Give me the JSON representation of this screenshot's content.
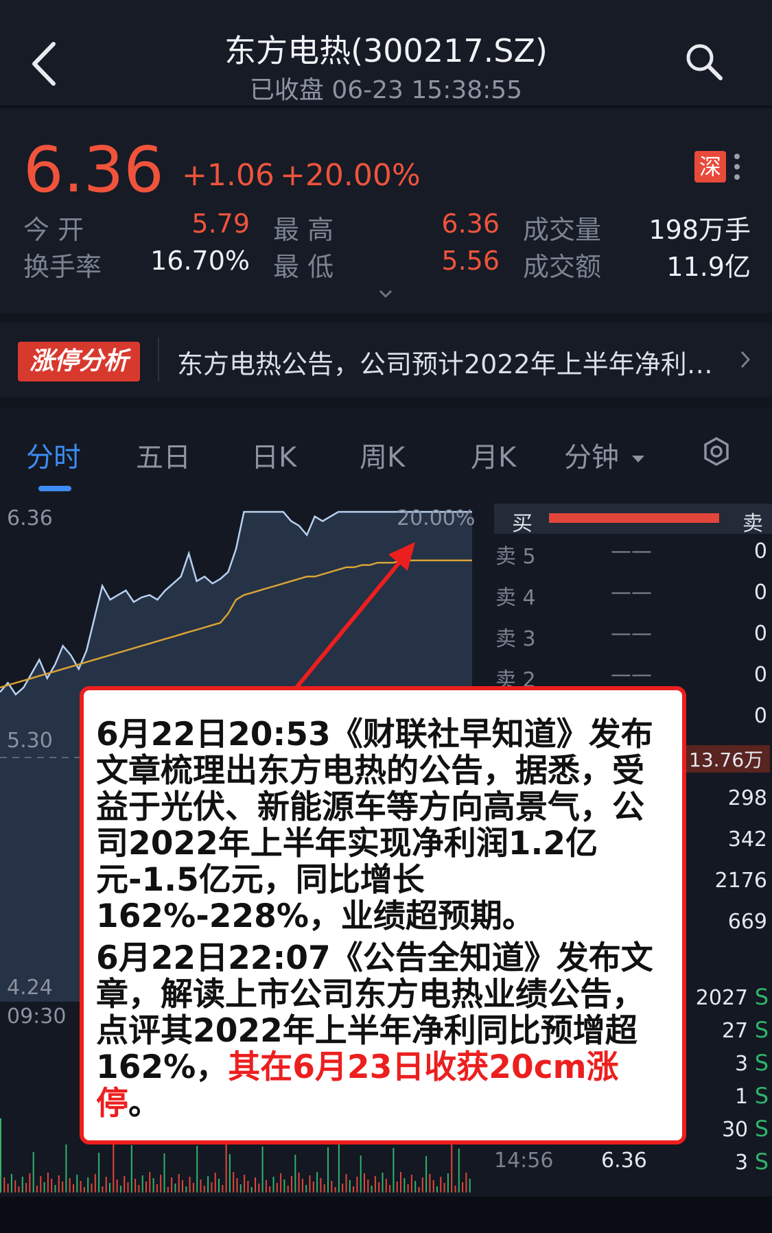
{
  "header": {
    "title": "东方电热(300217.SZ)",
    "subtitle": "已收盘 06-23 15:38:55"
  },
  "quote": {
    "price": "6.36",
    "change": "+1.06",
    "change_pct": "+20.00%",
    "exchange_badge": "深",
    "stats": {
      "open_label": "今 开",
      "open_value": "5.79",
      "turnover_label": "换手率",
      "turnover_value": "16.70%",
      "high_label": "最 高",
      "high_value": "6.36",
      "low_label": "最 低",
      "low_value": "5.56",
      "volume_label": "成交量",
      "volume_value": "198万手",
      "amount_label": "成交额",
      "amount_value": "11.9亿"
    }
  },
  "notice": {
    "tag": "涨停分析",
    "text": "东方电热公告，公司预计2022年上半年净利…"
  },
  "tabs": [
    {
      "label": "分时",
      "active": true
    },
    {
      "label": "五日"
    },
    {
      "label": "日K"
    },
    {
      "label": "周K"
    },
    {
      "label": "月K"
    },
    {
      "label": "分钟"
    }
  ],
  "chart_data": {
    "type": "line",
    "y_labels": [
      "6.36",
      "5.30",
      "4.24"
    ],
    "x_labels": [
      "09:30"
    ],
    "pct_label": "20.00%",
    "ylim": [
      4.24,
      6.36
    ],
    "price_series": [
      5.58,
      5.62,
      5.57,
      5.6,
      5.66,
      5.72,
      5.64,
      5.7,
      5.78,
      5.74,
      5.68,
      5.76,
      5.9,
      6.04,
      5.98,
      6.0,
      6.02,
      5.97,
      5.99,
      6.0,
      5.98,
      6.02,
      6.05,
      6.08,
      6.18,
      6.06,
      6.08,
      6.05,
      6.07,
      6.1,
      6.2,
      6.36,
      6.36,
      6.36,
      6.36,
      6.36,
      6.36,
      6.32,
      6.3,
      6.26,
      6.34,
      6.32,
      6.34,
      6.36,
      6.36,
      6.36,
      6.36,
      6.36,
      6.36,
      6.36,
      6.36,
      6.36,
      6.36,
      6.36,
      6.36,
      6.36,
      6.36,
      6.36,
      6.36,
      6.36,
      6.36
    ],
    "avg_series": [
      5.6,
      5.61,
      5.62,
      5.63,
      5.64,
      5.65,
      5.66,
      5.67,
      5.68,
      5.69,
      5.7,
      5.71,
      5.72,
      5.73,
      5.74,
      5.75,
      5.76,
      5.77,
      5.78,
      5.79,
      5.8,
      5.81,
      5.82,
      5.83,
      5.84,
      5.85,
      5.86,
      5.87,
      5.88,
      5.92,
      5.98,
      6.0,
      6.01,
      6.02,
      6.03,
      6.04,
      6.05,
      6.06,
      6.07,
      6.08,
      6.08,
      6.09,
      6.1,
      6.11,
      6.12,
      6.12,
      6.13,
      6.13,
      6.14,
      6.14,
      6.14,
      6.15,
      6.15,
      6.15,
      6.15,
      6.15,
      6.15,
      6.15,
      6.15,
      6.15,
      6.15
    ]
  },
  "order_book": {
    "buy_label": "买",
    "sell_label": "卖",
    "asks": [
      {
        "label": "卖 5",
        "price": "——",
        "vol": "0"
      },
      {
        "label": "卖 4",
        "price": "——",
        "vol": "0"
      },
      {
        "label": "卖 3",
        "price": "——",
        "vol": "0"
      },
      {
        "label": "卖 2",
        "price": "——",
        "vol": "0"
      },
      {
        "label": "",
        "price": "",
        "vol": "0"
      }
    ],
    "bid_volume": "13.76万",
    "bid_vols": [
      "298",
      "342",
      "2176",
      "669"
    ],
    "ticks": [
      {
        "vol": "2027",
        "side": "S"
      },
      {
        "vol": "27",
        "side": "S"
      },
      {
        "vol": "3",
        "side": "S"
      },
      {
        "vol": "1",
        "side": "S"
      },
      {
        "vol": "30",
        "side": "S"
      },
      {
        "time": "14:56",
        "price": "6.36",
        "vol": "3",
        "side": "S"
      }
    ]
  },
  "note": {
    "para1": "6月22日20:53《财联社早知道》发布文章梳理出东方电热的公告，据悉，受益于光伏、新能源车等方向高景气，公司2022年上半年实现净利润1.2亿元-1.5亿元，同比增长162%-228%，业绩超预期。",
    "para2_a": "6月22日22:07《公告全知道》发布文章，解读上市公司东方电热业绩公告，点评其2022年上半年净利同比预增超162%，",
    "para2_b": "其在6月23日收获20cm涨停",
    "para2_c": "。"
  },
  "colors": {
    "up": "#f0533c",
    "accent": "#3e8cf4",
    "avg_line": "#d9a336",
    "price_line": "#b8d0f2",
    "annotation": "#ec1f1f",
    "tick_sell": "#2fb36b"
  }
}
